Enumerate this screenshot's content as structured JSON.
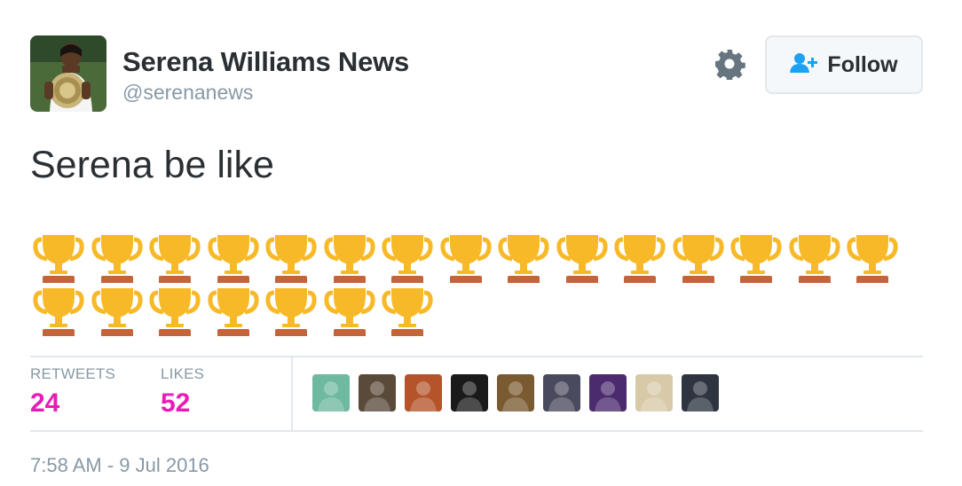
{
  "tweet": {
    "author_name": "Serena Williams News",
    "screen_name": "@serenanews",
    "text": "Serena be like",
    "trophy_rows": [
      15,
      7
    ],
    "timestamp": "7:58 AM - 9 Jul 2016"
  },
  "actions": {
    "follow_label": "Follow",
    "follow_icon": "add-user-icon",
    "settings_icon": "gear-icon"
  },
  "stats": {
    "retweets_label": "RETWEETS",
    "retweets_count": "24",
    "likes_label": "LIKES",
    "likes_count": "52"
  },
  "likers": [
    {
      "name": "liker-avatar-1",
      "bg": "#6fb9a0"
    },
    {
      "name": "liker-avatar-2",
      "bg": "#5a4a3a"
    },
    {
      "name": "liker-avatar-3",
      "bg": "#b5542a"
    },
    {
      "name": "liker-avatar-4",
      "bg": "#1a1a1a"
    },
    {
      "name": "liker-avatar-5",
      "bg": "#7a5a30"
    },
    {
      "name": "liker-avatar-6",
      "bg": "#4a4a5e"
    },
    {
      "name": "liker-avatar-7",
      "bg": "#4b2a6e"
    },
    {
      "name": "liker-avatar-8",
      "bg": "#d8c9a8"
    },
    {
      "name": "liker-avatar-9",
      "bg": "#2e3540"
    }
  ],
  "colors": {
    "primary_text": "#292f33",
    "secondary_text": "#8899a6",
    "stat_count": "#e81cb7",
    "follow_icon": "#1da1f2",
    "trophy_gold": "#f7b928",
    "trophy_base": "#c4643a"
  }
}
